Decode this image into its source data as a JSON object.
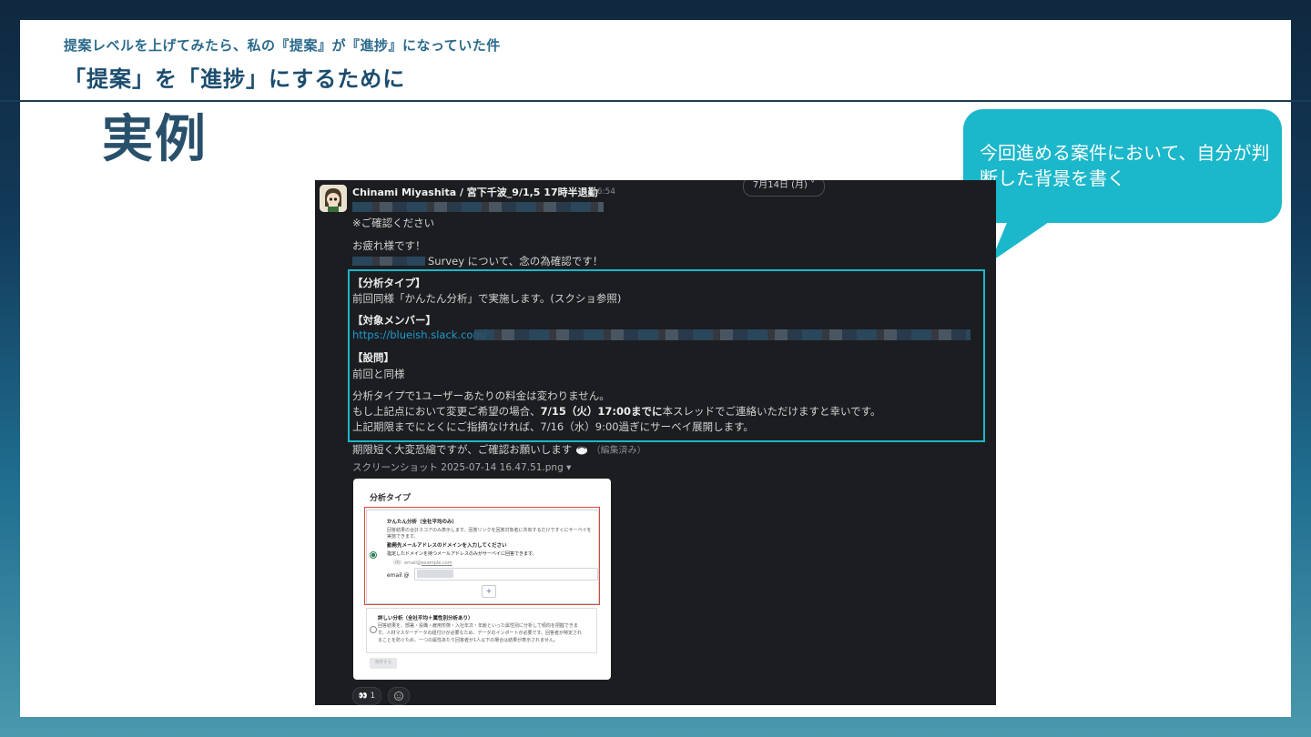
{
  "slide": {
    "pretitle": "提案レベルを上げてみたら、私の『提案』が『進捗』になっていた件",
    "title": "「提案」を「進捗」にするために",
    "example_heading": "実例",
    "callout": "今回進める案件において、自分が判断した背景を書く"
  },
  "colors": {
    "accent": "#1bb7cb",
    "title": "#1b4c6e",
    "slack_bg": "#1b1d21",
    "link": "#1d9bd1",
    "red_outline": "#d9493b"
  },
  "message": {
    "author": "Chinami Miyashita / 宮下千波_9/1,5 17時半退勤",
    "time": "16:54",
    "date_pill": "7月14日 (月) ˅",
    "line_confirm": "※ご確認ください",
    "line_greeting": "お疲れ様です！",
    "line_survey": "Survey について、念の為確認です！",
    "section1_head": "【分析タイプ】",
    "section1_body": "前回同様「かんたん分析」で実施します。(スクショ参照)",
    "section2_head": "【対象メンバー】",
    "section2_link": "https://blueish.slack.com/",
    "section3_head": "【設問】",
    "section3_body": "前回と同様",
    "note1": "分析タイプで1ユーザーあたりの料金は変わりません。",
    "note2_a": "もし上記点において変更ご希望の場合、",
    "note2_b": "7/15（火）17:00までに",
    "note2_c": "本スレッドでご連絡いただけますと幸いです。",
    "note3": "上記期限までにとくにご指摘なければ、7/16（水）9:00過ぎにサーベイ展開します。",
    "closing": "期限短く大変恐縮ですが、ご確認お願いします",
    "edited": "（編集済み）",
    "file_name": "スクリーンショット 2025-07-14 16.47.51.png ▾",
    "reaction_count": "1",
    "reaction_emoji": "👀"
  },
  "screenshot_card": {
    "title": "分析タイプ",
    "opt1_title": "かんたん分析（全社平均のみ）",
    "opt1_desc1": "回答結果の合計スコアのみ表示します。回答リンクを回答対象者に共有するだけですぐにサーベイを",
    "opt1_desc2": "実施できます。",
    "opt1_domain_label": "勤務先メールアドレスのドメインを入力してください",
    "opt1_domain_desc": "指定したドメインを持つメールアドレスのみがサーベイに回答できます。",
    "opt1_example_prefix": "（例）email@",
    "opt1_example_domain": "example.com",
    "email_label": "email @",
    "add_button": "+",
    "opt2_title": "詳しい分析（全社平均＋属性別分析あり）",
    "opt2_desc1": "回答結果を、部署・役職・雇用形態・入社年次・年齢といった属性別に分析して傾向を把握できま",
    "opt2_desc2": "す。人材マスターデータの紐付けが必要なため、データのインポートが必要です。回答者が特定され",
    "opt2_desc3": "ることを防ぐため、一つの属性あたり回答者が1人以下の場合は結果が表示されません。",
    "save_button": "保存する"
  }
}
